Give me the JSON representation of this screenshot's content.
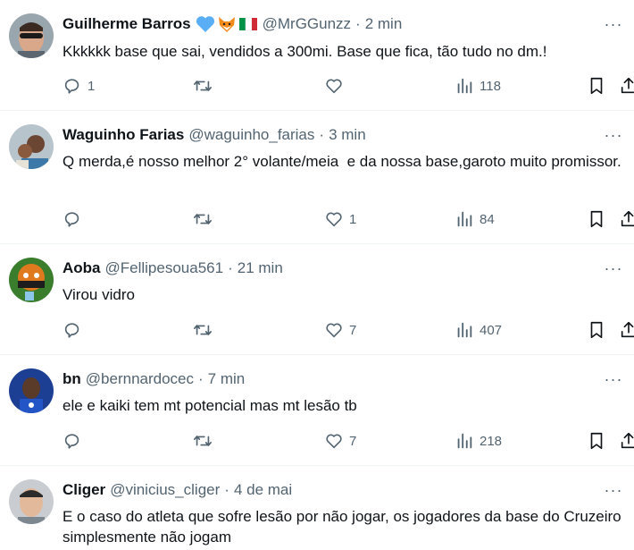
{
  "colors": {
    "text_primary": "#0f1419",
    "text_secondary": "#536471",
    "divider": "#eff3f4",
    "badge_blue_heart": "#5aaef5",
    "flag_green": "#009246",
    "flag_red": "#ce2b37"
  },
  "tweets": [
    {
      "name": "Guilherme Barros",
      "badges": [
        "blue-heart-emoji",
        "fox-face-emoji",
        "italy-flag-emoji"
      ],
      "handle": "@MrGGunzz",
      "dot": "·",
      "time": "2 min",
      "text": "Kkkkkk base que sai, vendidos a 300mi. Base que fica, tão tudo no dm.!",
      "replies": "1",
      "retweets": "",
      "likes": "",
      "views": "118"
    },
    {
      "name": "Waguinho Farias",
      "badges": [],
      "handle": "@waguinho_farias",
      "dot": "·",
      "time": "3 min",
      "text": "Q merda,é nosso melhor 2° volante/meia  e da nossa base,garoto muito promissor.",
      "replies": "",
      "retweets": "",
      "likes": "1",
      "views": "84"
    },
    {
      "name": "Aoba",
      "badges": [],
      "handle": "@Fellipesoua561",
      "dot": "·",
      "time": "21 min",
      "text": "Virou vidro",
      "replies": "",
      "retweets": "",
      "likes": "7",
      "views": "407"
    },
    {
      "name": "bn",
      "badges": [],
      "handle": "@bernnardocec",
      "dot": "·",
      "time": "7 min",
      "text": "ele e kaiki tem mt potencial mas mt lesão tb",
      "replies": "",
      "retweets": "",
      "likes": "7",
      "views": "218"
    },
    {
      "name": "Cliger",
      "badges": [],
      "handle": "@vinicius_cliger",
      "dot": "·",
      "time": "4 de mai",
      "text": "E o caso do atleta que sofre lesão por não jogar, os jogadores da base do Cruzeiro simplesmente não jogam",
      "replies": "",
      "retweets": "",
      "likes": "",
      "views": ""
    }
  ],
  "icons": {
    "reply": "reply-icon",
    "retweet": "retweet-icon",
    "like": "heart-icon",
    "views": "views-chart-icon",
    "bookmark": "bookmark-icon",
    "share": "share-icon",
    "more": "more-options-icon"
  },
  "more_glyph": "···"
}
